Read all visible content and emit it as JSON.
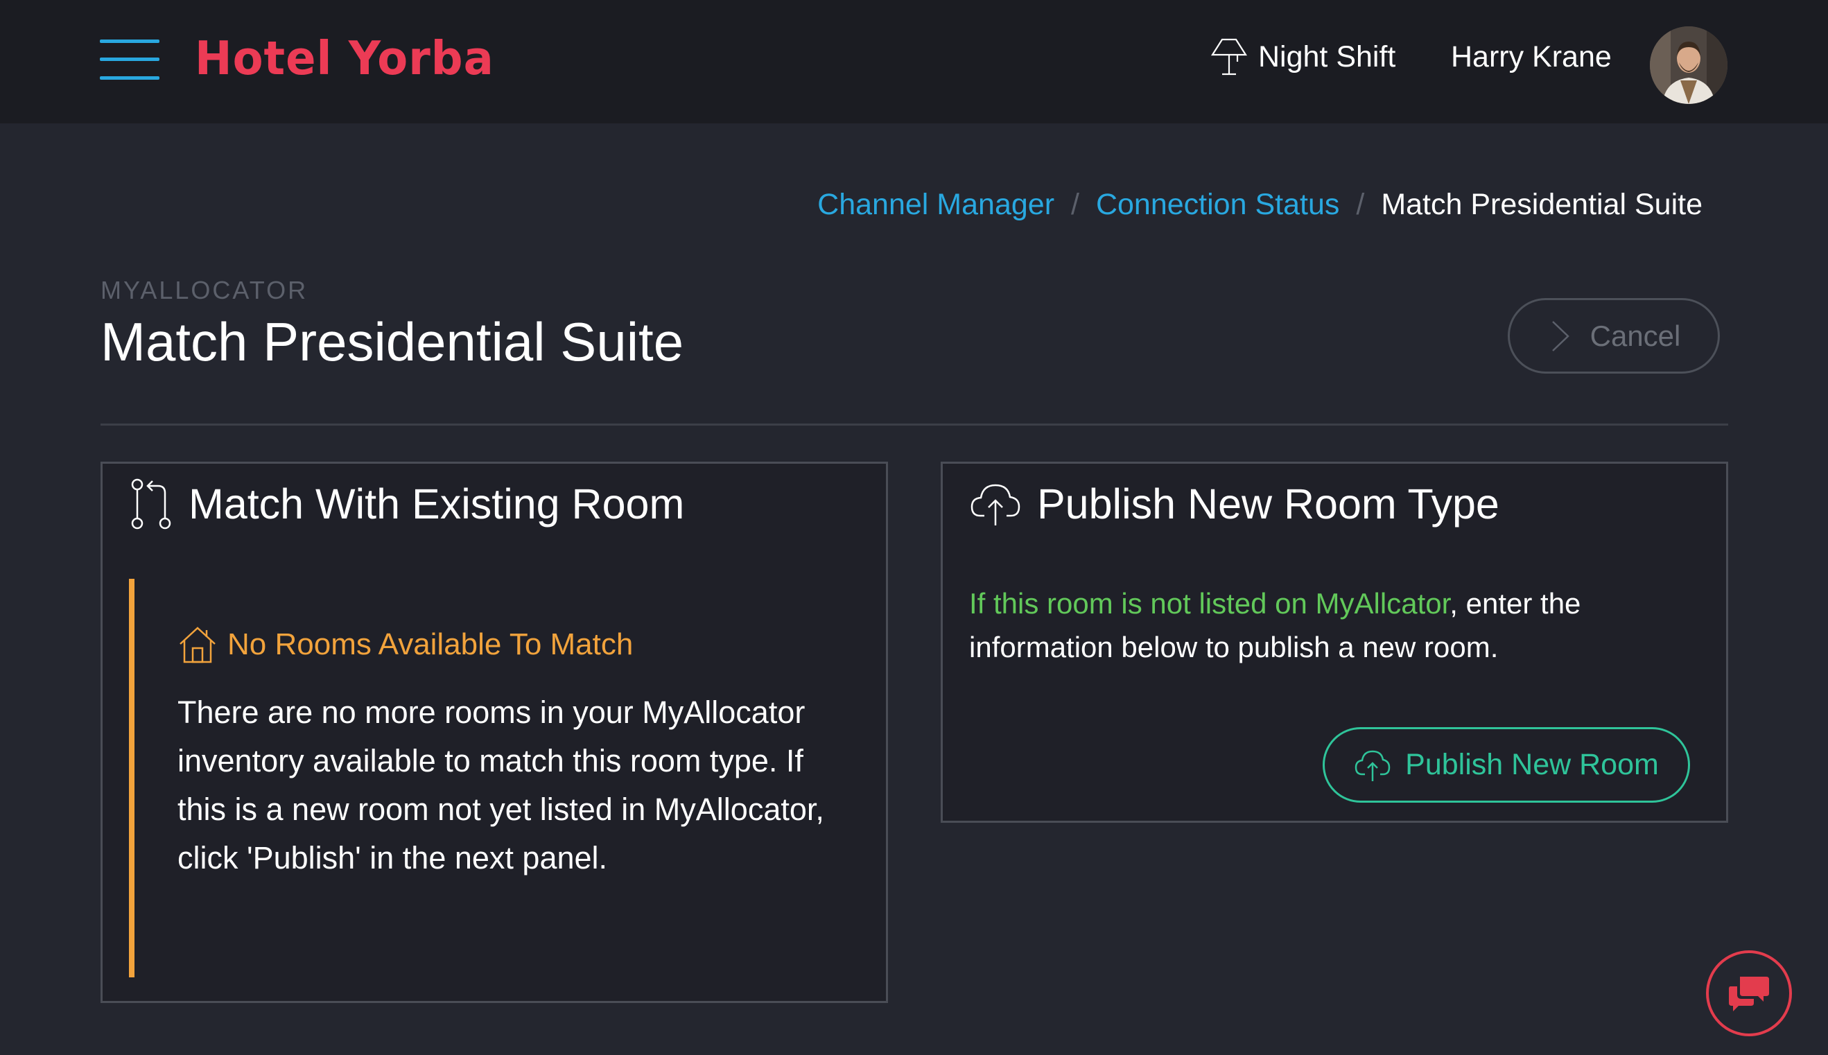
{
  "header": {
    "brand": "Hotel Yorba",
    "shift_label": "Night Shift",
    "user_name": "Harry Krane"
  },
  "breadcrumb": {
    "items": [
      "Channel Manager",
      "Connection Status"
    ],
    "current": "Match Presidential Suite",
    "separator": "/"
  },
  "page": {
    "eyebrow": "MYALLOCATOR",
    "title": "Match Presidential Suite",
    "cancel_label": "Cancel"
  },
  "match_panel": {
    "title": "Match With Existing Room",
    "alert_title": "No Rooms Available To Match",
    "alert_body": "There are no more rooms in your MyAllocator inventory available to match this room type. If this is a new room not yet listed in MyAllocator, click 'Publish' in the next panel."
  },
  "publish_panel": {
    "title": "Publish New Room Type",
    "text_highlight": "If this room is not listed on MyAllcator",
    "text_rest": ", enter the information below to publish a new room.",
    "button_label": "Publish New Room"
  },
  "colors": {
    "accent_blue": "#29a8e0",
    "brand_red": "#ec3b55",
    "warning_orange": "#f2a33c",
    "success_green": "#2fc49a",
    "highlight_green": "#62c95a"
  },
  "icons": {
    "menu": "hamburger-icon",
    "shift": "lamp-icon",
    "cancel": "chevron-right-icon",
    "match": "git-compare-icon",
    "publish": "cloud-upload-icon",
    "alert": "house-icon",
    "chat": "chat-bubbles-icon"
  }
}
